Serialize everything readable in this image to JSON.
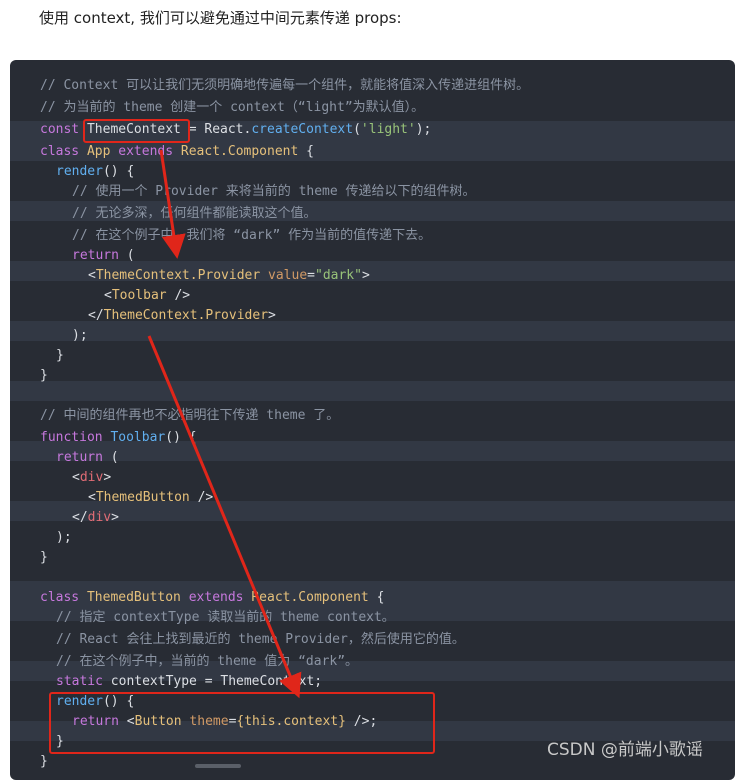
{
  "intro_text": "使用 context, 我们可以避免通过中间元素传递 props:",
  "code": {
    "l1": "// Context 可以让我们无须明确地传遍每一个组件，就能将值深入传递进组件树。",
    "l2": "// 为当前的 theme 创建一个 context（“light”为默认值）。",
    "l3": {
      "kw": "const",
      "name": "ThemeContext",
      "eq": " = React.",
      "fn": "createContext",
      "open": "(",
      "str": "'light'",
      "close": ");"
    },
    "l4": {
      "kw": "class",
      "name": "App",
      "ext": "extends",
      "cls": "React.Component",
      "brace": " {"
    },
    "l5": {
      "fn": "render",
      "rest": "() {"
    },
    "l6": "// 使用一个 Provider 来将当前的 theme 传递给以下的组件树。",
    "l7": "// 无论多深，任何组件都能读取这个值。",
    "l8": "// 在这个例子中，我们将 “dark” 作为当前的值传递下去。",
    "l9": {
      "kw": "return",
      "rest": " ("
    },
    "l10": {
      "lt": "<",
      "tag": "ThemeContext.Provider",
      "attr": " value",
      "eq": "=",
      "str": "\"dark\"",
      "gt": ">"
    },
    "l11": {
      "lt": "<",
      "tag": "Toolbar",
      "end": " />"
    },
    "l12": {
      "lt": "</",
      "tag": "ThemeContext.Provider",
      "gt": ">"
    },
    "l13": ");",
    "l14": "}",
    "l15": "}",
    "l17": "// 中间的组件再也不必指明往下传递 theme 了。",
    "l18": {
      "kw": "function",
      "fn": "Toolbar",
      "rest": "() {"
    },
    "l19": {
      "kw": "return",
      "rest": " ("
    },
    "l20": {
      "lt": "<",
      "tag": "div",
      "gt": ">"
    },
    "l21": {
      "lt": "<",
      "tag": "ThemedButton",
      "end": " />"
    },
    "l22": {
      "lt": "</",
      "tag": "div",
      "gt": ">"
    },
    "l23": ");",
    "l24": "}",
    "l26": {
      "kw": "class",
      "name": "ThemedButton",
      "ext": "extends",
      "cls": "React.Component",
      "brace": " {"
    },
    "l27": "// 指定 contextType 读取当前的 theme context。",
    "l28": "// React 会往上找到最近的 theme Provider，然后使用它的值。",
    "l29": "// 在这个例子中，当前的 theme 值为 “dark”。",
    "l30": {
      "kw": "static",
      "rest": " contextType = ThemeContext;"
    },
    "l31": {
      "fn": "render",
      "rest": "() {"
    },
    "l32": {
      "kw": "return",
      "lt": " <",
      "tag": "Button",
      "attr": " theme",
      "eq": "=",
      "expr": "{this.context}",
      "end": " />;"
    },
    "l33": "}",
    "l34": "}"
  },
  "watermark": "CSDN @前端小歌谣",
  "colors": {
    "annotation_red": "#e0261a",
    "code_bg": "#282c34"
  }
}
